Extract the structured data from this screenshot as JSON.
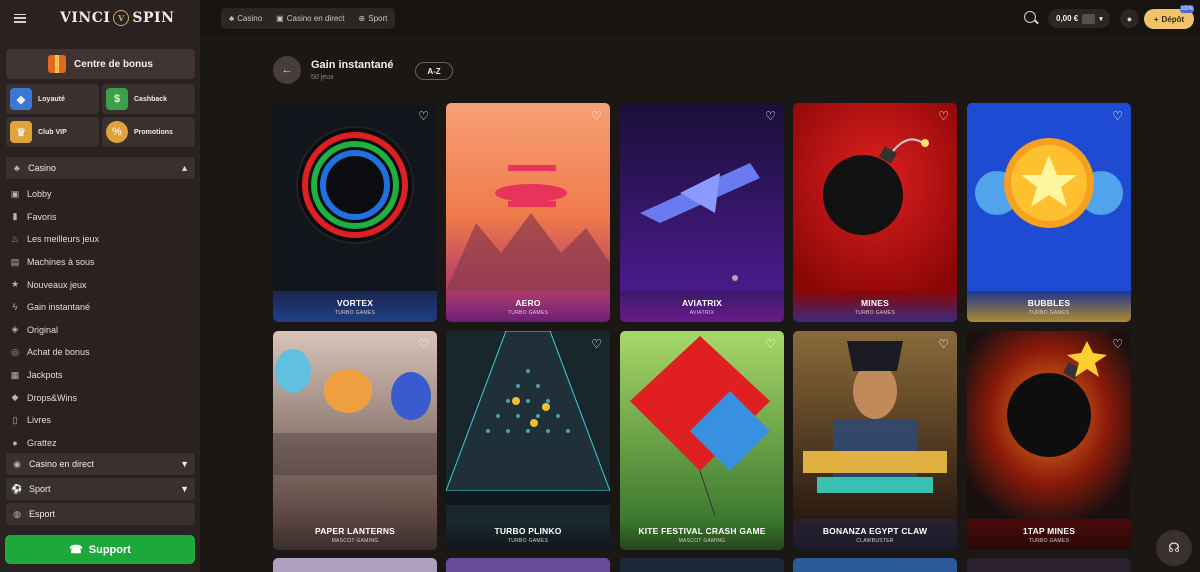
{
  "brand": {
    "name_left": "VINCI",
    "name_right": "SPIN"
  },
  "sidebar": {
    "bonus_center": "Centre de bonus",
    "quick": [
      {
        "label": "Loyauté",
        "icon": "shield-icon",
        "color": "#3a78d8"
      },
      {
        "label": "Cashback",
        "icon": "cash-icon",
        "color": "#3aa04a"
      },
      {
        "label": "Club VIP",
        "icon": "crown-icon",
        "color": "#e0a23a"
      },
      {
        "label": "Promotions",
        "icon": "percent-icon",
        "color": "#e0a23a"
      }
    ],
    "casino_label": "Casino",
    "items": [
      {
        "label": "Lobby",
        "icon": "lobby-icon"
      },
      {
        "label": "Favoris",
        "icon": "bookmark-icon"
      },
      {
        "label": "Les meilleurs jeux",
        "icon": "flame-icon"
      },
      {
        "label": "Machines à sous",
        "icon": "slot-icon"
      },
      {
        "label": "Nouveaux jeux",
        "icon": "star-icon"
      },
      {
        "label": "Gain instantané",
        "icon": "bolt-icon"
      },
      {
        "label": "Original",
        "icon": "original-icon"
      },
      {
        "label": "Achat de bonus",
        "icon": "medal-icon"
      },
      {
        "label": "Jackpots",
        "icon": "jackpot-icon"
      },
      {
        "label": "Drops&Wins",
        "icon": "drops-icon"
      },
      {
        "label": "Livres",
        "icon": "book-icon"
      },
      {
        "label": "Grattez",
        "icon": "scratch-icon"
      }
    ],
    "live_casino": "Casino en direct",
    "sport": "Sport",
    "esport": "Esport",
    "support": "Support"
  },
  "topbar": {
    "tabs": [
      "Casino",
      "Casino en direct",
      "Sport"
    ],
    "balance": "0,00 €",
    "deposit": "Dépôt",
    "deposit_badge": "100%"
  },
  "page": {
    "title": "Gain instantané",
    "subtitle": "50 jeux",
    "sort": "A-Z"
  },
  "games": [
    {
      "title": "VORTEX",
      "provider": "TURBO GAMES",
      "bg": "#13151c",
      "footer": "#1f3f86"
    },
    {
      "title": "AERO",
      "provider": "TURBO GAMES",
      "bg": "#f08a5a",
      "footer": "#8e2a8e"
    },
    {
      "title": "AVIATRIX",
      "provider": "AVIATRIX",
      "bg": "#3b1a7a",
      "footer": "#4a1a7a"
    },
    {
      "title": "MINES",
      "provider": "TURBO GAMES",
      "bg": "#c81010",
      "footer": "#7a0a0a"
    },
    {
      "title": "BUBBLES",
      "provider": "TURBO GAMES",
      "bg": "#1e4bd1",
      "footer": "#1c3590"
    },
    {
      "title": "PAPER LANTERNS",
      "provider": "MASCOT GAMING",
      "bg": "#b89a8a",
      "footer": "#5a4540"
    },
    {
      "title": "TURBO PLINKO",
      "provider": "TURBO GAMES",
      "bg": "#19262c",
      "footer": "#1a2a32"
    },
    {
      "title": "KITE FESTIVAL CRASH GAME",
      "provider": "MASCOT GAMING",
      "bg": "#5ea04a",
      "footer": "#2e5a26"
    },
    {
      "title": "BONANZA EGYPT CLAW",
      "provider": "CLAWBUSTER",
      "bg": "#6a4a2a",
      "footer": "#2a2a3a"
    },
    {
      "title": "1TAP MINES",
      "provider": "TURBO GAMES",
      "bg": "#1a1010",
      "footer": "#4a0a0a"
    }
  ],
  "colors": {
    "accent_green": "#1ea83a",
    "deposit_gold": "#f2c46a",
    "sidebar_bg": "#2a2220"
  }
}
